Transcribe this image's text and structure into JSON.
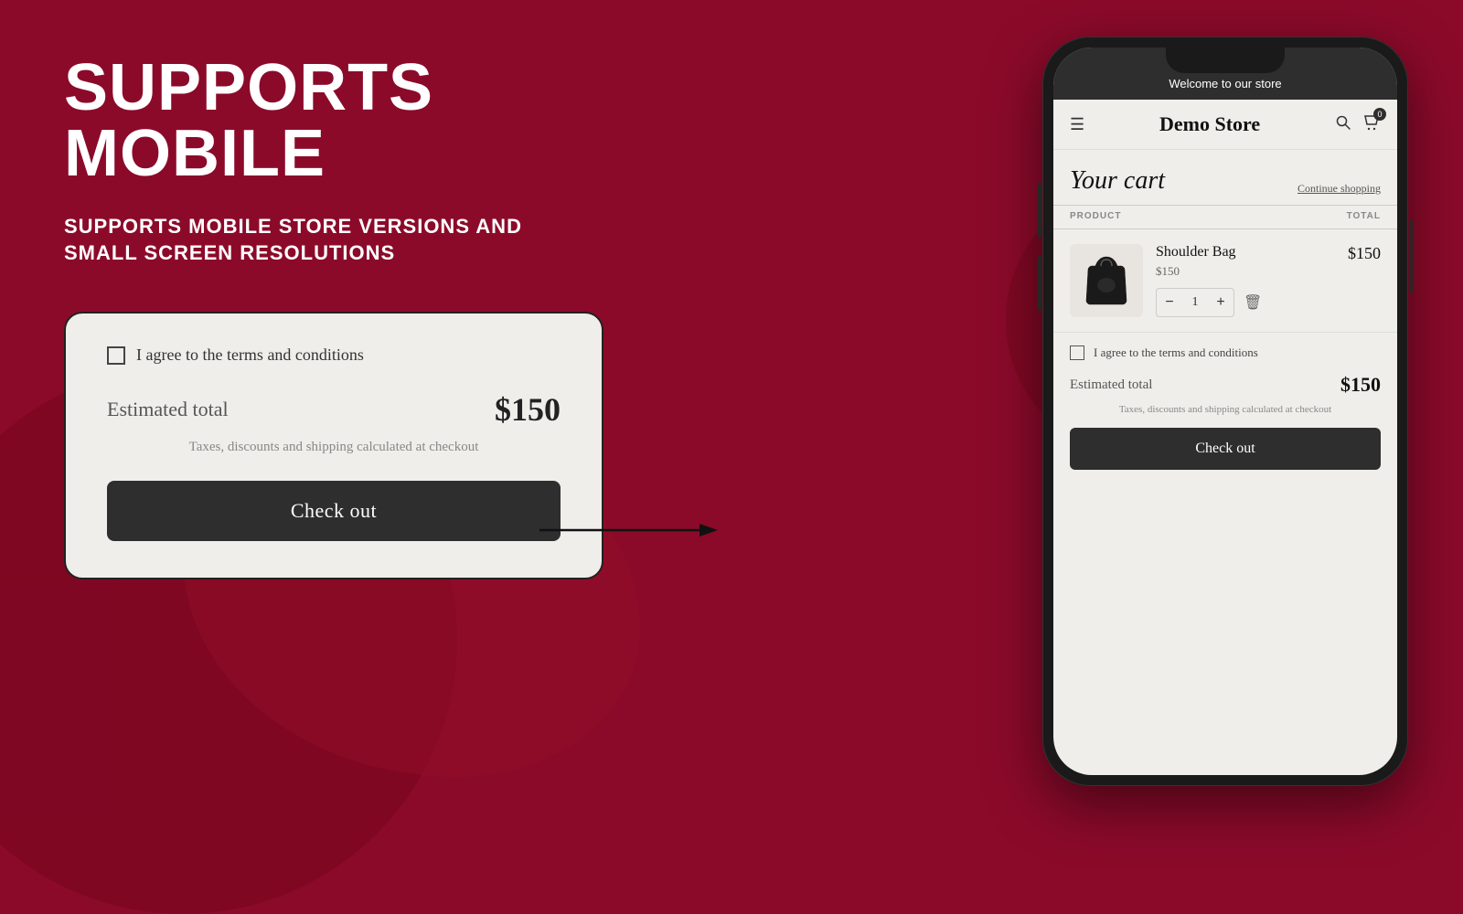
{
  "background": {
    "color": "#8B0A2A"
  },
  "left": {
    "main_title": "SUPPORTS MOBILE",
    "subtitle_line1": "SUPPORTS MOBILE STORE VERSIONS AND",
    "subtitle_line2": "SMALL SCREEN RESOLUTIONS",
    "card": {
      "checkbox_label": "I agree to the terms and conditions",
      "estimated_label": "Estimated total",
      "estimated_amount": "$150",
      "tax_note": "Taxes, discounts and shipping calculated at checkout",
      "checkout_btn": "Check out"
    }
  },
  "phone": {
    "status_bar_text": "Welcome to our store",
    "store_name": "Demo Store",
    "cart_badge": "0",
    "cart_title": "Your cart",
    "continue_shopping": "Continue shopping",
    "table_headers": {
      "product": "PRODUCT",
      "total": "TOTAL"
    },
    "product": {
      "name": "Shoulder Bag",
      "price": "$150",
      "qty": "1",
      "total": "$150"
    },
    "footer": {
      "checkbox_label": "I agree to the terms and conditions",
      "estimated_label": "Estimated total",
      "estimated_amount": "$150",
      "tax_note": "Taxes, discounts and shipping calculated at checkout",
      "checkout_btn": "Check out"
    }
  }
}
